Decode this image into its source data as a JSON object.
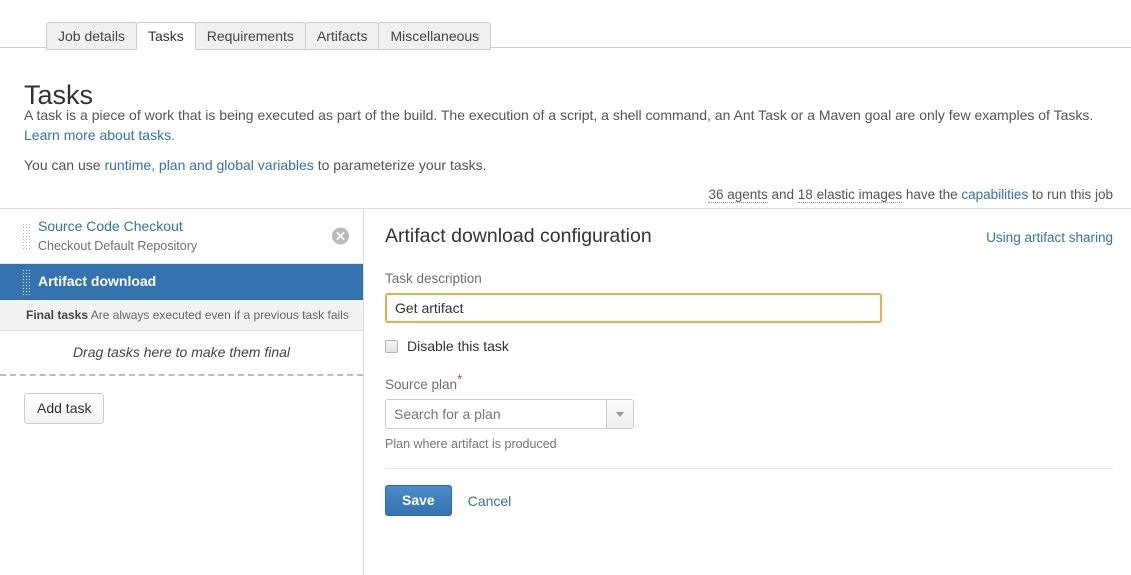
{
  "tabs": [
    {
      "label": "Job details",
      "active": false
    },
    {
      "label": "Tasks",
      "active": true
    },
    {
      "label": "Requirements",
      "active": false
    },
    {
      "label": "Artifacts",
      "active": false
    },
    {
      "label": "Miscellaneous",
      "active": false
    }
  ],
  "page": {
    "title": "Tasks",
    "intro_part1": "A task is a piece of work that is being executed as part of the build. The execution of a script, a shell command, an Ant Task or a Maven goal are only few examples of Tasks. ",
    "intro_link": "Learn more about tasks.",
    "intro2_part1": "You can use ",
    "intro2_link": "runtime, plan and global variables",
    "intro2_part2": " to parameterize your tasks."
  },
  "agents": {
    "agent_count": "36 agents",
    "middle": " and ",
    "image_count": "18 elastic images",
    "after": " have the ",
    "capabilities_link": "capabilities",
    "tail": " to run this job"
  },
  "task_list": {
    "tasks": [
      {
        "title": "Source Code Checkout",
        "subtitle": "Checkout Default Repository",
        "selected": false
      },
      {
        "title": "Artifact download",
        "subtitle": "",
        "selected": true
      }
    ],
    "final_tasks_label": "Final tasks",
    "final_tasks_desc": "Are always executed even if a previous task fails",
    "dropzone_text": "Drag tasks here to make them final",
    "add_task_label": "Add task"
  },
  "config": {
    "title": "Artifact download configuration",
    "help_link": "Using artifact sharing",
    "task_description_label": "Task description",
    "task_description_value": "Get artifact",
    "task_description_placeholder": "",
    "disable_task_label": "Disable this task",
    "source_plan_label": "Source plan",
    "required_marker": "*",
    "source_plan_value": "",
    "source_plan_placeholder": "Search for a plan",
    "source_plan_help": "Plan where artifact is produced",
    "save_label": "Save",
    "cancel_label": "Cancel"
  },
  "colors": {
    "accent": "#3572b0",
    "focus_border": "#f0ad4e",
    "required": "#d04437"
  }
}
